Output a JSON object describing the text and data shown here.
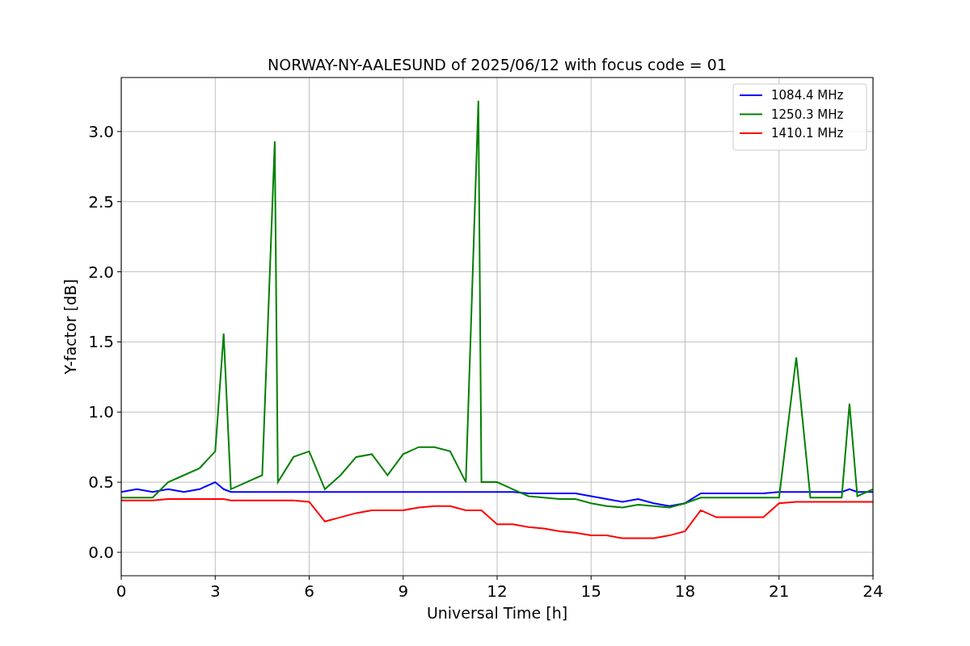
{
  "chart": {
    "chart_data": {
      "type": "line",
      "title": "NORWAY-NY-AALESUND of 2025/06/12 with focus code = 01",
      "xlabel": "Universal Time [h]",
      "ylabel": "Y-factor [dB]",
      "x": [
        0,
        0.5,
        1,
        1.5,
        2,
        2.5,
        3,
        3.27,
        3.5,
        4,
        4.5,
        4.9,
        5,
        5.5,
        6,
        6.5,
        7,
        7.5,
        8,
        8.5,
        9,
        9.5,
        10,
        10.5,
        11,
        11.4,
        11.5,
        12,
        12.5,
        13,
        13.5,
        14,
        14.5,
        15,
        15.5,
        16,
        16.5,
        17,
        17.5,
        18,
        18.5,
        19,
        19.5,
        20,
        20.5,
        21,
        21.55,
        22,
        22.5,
        23,
        23.25,
        23.5,
        24
      ],
      "series": [
        {
          "name": "1084.4 MHz",
          "color": "#0000ff",
          "values": [
            0.43,
            0.45,
            0.43,
            0.45,
            0.43,
            0.45,
            0.5,
            0.45,
            0.43,
            0.43,
            0.43,
            0.43,
            0.43,
            0.43,
            0.43,
            0.43,
            0.43,
            0.43,
            0.43,
            0.43,
            0.43,
            0.43,
            0.43,
            0.43,
            0.43,
            0.43,
            0.43,
            0.43,
            0.43,
            0.42,
            0.42,
            0.42,
            0.42,
            0.4,
            0.38,
            0.36,
            0.38,
            0.35,
            0.33,
            0.35,
            0.42,
            0.42,
            0.42,
            0.42,
            0.42,
            0.43,
            0.43,
            0.43,
            0.43,
            0.43,
            0.45,
            0.43,
            0.43
          ]
        },
        {
          "name": "1250.3 MHz",
          "color": "#008000",
          "values": [
            0.39,
            0.39,
            0.39,
            0.5,
            0.55,
            0.6,
            0.72,
            1.56,
            0.45,
            0.5,
            0.55,
            2.93,
            0.5,
            0.68,
            0.72,
            0.45,
            0.55,
            0.68,
            0.7,
            0.55,
            0.7,
            0.75,
            0.75,
            0.72,
            0.5,
            3.22,
            0.5,
            0.5,
            0.45,
            0.4,
            0.39,
            0.38,
            0.38,
            0.35,
            0.33,
            0.32,
            0.34,
            0.33,
            0.32,
            0.35,
            0.39,
            0.39,
            0.39,
            0.39,
            0.39,
            0.39,
            1.39,
            0.39,
            0.39,
            0.39,
            1.06,
            0.4,
            0.45
          ]
        },
        {
          "name": "1410.1 MHz",
          "color": "#ff0000",
          "values": [
            0.37,
            0.37,
            0.37,
            0.38,
            0.38,
            0.38,
            0.38,
            0.38,
            0.37,
            0.37,
            0.37,
            0.37,
            0.37,
            0.37,
            0.36,
            0.22,
            0.25,
            0.28,
            0.3,
            0.3,
            0.3,
            0.32,
            0.33,
            0.33,
            0.3,
            0.3,
            0.3,
            0.2,
            0.2,
            0.18,
            0.17,
            0.15,
            0.14,
            0.12,
            0.12,
            0.1,
            0.1,
            0.1,
            0.12,
            0.15,
            0.3,
            0.25,
            0.25,
            0.25,
            0.25,
            0.35,
            0.36,
            0.36,
            0.36,
            0.36,
            0.36,
            0.36,
            0.36
          ]
        }
      ],
      "grid": true,
      "legend": true,
      "xlim": [
        0,
        24
      ],
      "ylim": [
        -0.167,
        3.385
      ],
      "xticks": [
        0,
        3,
        6,
        9,
        12,
        15,
        18,
        21,
        24
      ],
      "yticks": [
        {
          "value": 0,
          "label": "0.0"
        },
        {
          "value": 0.5,
          "label": "0.5"
        },
        {
          "value": 1,
          "label": "1.0"
        },
        {
          "value": 1.5,
          "label": "1.5"
        },
        {
          "value": 2,
          "label": "2.0"
        },
        {
          "value": 2.5,
          "label": "2.5"
        },
        {
          "value": 3,
          "label": "3.0"
        }
      ]
    }
  }
}
